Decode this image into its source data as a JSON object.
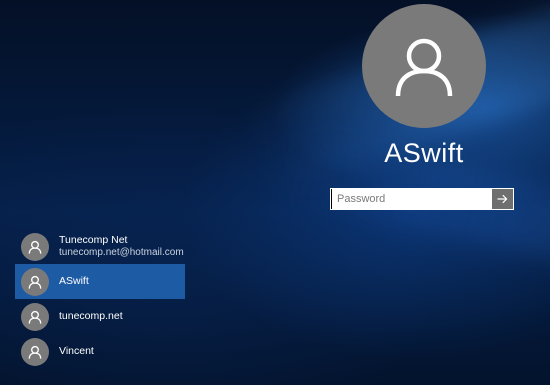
{
  "main_user": {
    "name": "ASwift",
    "avatar_icon": "user-silhouette-icon"
  },
  "password": {
    "placeholder": "Password",
    "value": "",
    "submit_icon": "arrow-right-icon"
  },
  "users": [
    {
      "name": "Tunecomp Net",
      "email": "tunecomp.net@hotmail.com",
      "selected": false,
      "avatar_icon": "user-silhouette-icon"
    },
    {
      "name": "ASwift",
      "email": "",
      "selected": true,
      "avatar_icon": "user-silhouette-icon"
    },
    {
      "name": "tunecomp.net",
      "email": "",
      "selected": false,
      "avatar_icon": "user-silhouette-icon"
    },
    {
      "name": "Vincent",
      "email": "",
      "selected": false,
      "avatar_icon": "user-silhouette-icon"
    }
  ],
  "colors": {
    "background": "#041630",
    "selection": "#1e5ba5",
    "avatar": "#7a7a7a",
    "submit_button": "#6f6f6f"
  }
}
